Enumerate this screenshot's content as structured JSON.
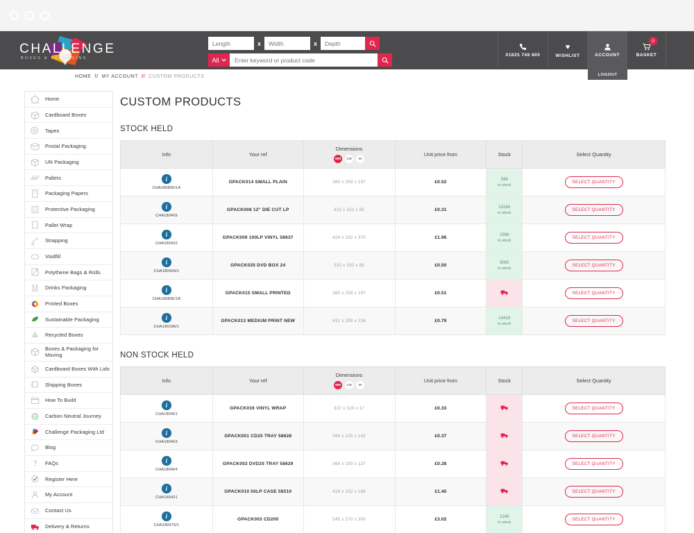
{
  "browser": {
    "dots": 3
  },
  "header": {
    "logo": {
      "name": "CHALLENGE",
      "tagline": "BOXES & PACKAGING"
    },
    "search": {
      "length_placeholder": "Length",
      "width_placeholder": "Width",
      "depth_placeholder": "Depth",
      "separator": "x",
      "category_selected": "All",
      "keyword_placeholder": "Enter keyword or product code",
      "search_icon": "search-icon"
    },
    "utils": [
      {
        "icon": "phone-icon",
        "glyph": "☎",
        "label": "01825 748 800",
        "name": "phone"
      },
      {
        "icon": "heart-icon",
        "glyph": "♥",
        "label": "WISHLIST",
        "name": "wishlist"
      },
      {
        "icon": "user-icon",
        "glyph": "♟",
        "label": "ACCOUNT",
        "name": "account",
        "sub": "LOGOUT"
      },
      {
        "icon": "cart-icon",
        "glyph": "⬟",
        "label": "BASKET",
        "name": "basket",
        "badge": "0"
      }
    ]
  },
  "breadcrumb": {
    "items": [
      "HOME",
      "MY ACCOUNT",
      "CUSTOM PRODUCTS"
    ],
    "separator": "//"
  },
  "sidebar": {
    "items": [
      {
        "label": "Home",
        "icon": "home-icon"
      },
      {
        "label": "Cardboard Boxes",
        "icon": "box-icon"
      },
      {
        "label": "Tapes",
        "icon": "tape-roll-icon"
      },
      {
        "label": "Postal Packaging",
        "icon": "envelope-box-icon"
      },
      {
        "label": "UN Packaging",
        "icon": "un-box-icon"
      },
      {
        "label": "Pallets",
        "icon": "pallet-icon"
      },
      {
        "label": "Packaging Papers",
        "icon": "paper-icon"
      },
      {
        "label": "Protective Packaging",
        "icon": "bubble-wrap-icon"
      },
      {
        "label": "Pallet Wrap",
        "icon": "wrap-icon"
      },
      {
        "label": "Strapping",
        "icon": "strapping-icon"
      },
      {
        "label": "Voidfill",
        "icon": "voidfill-icon"
      },
      {
        "label": "Polythene Bags & Rolls",
        "icon": "poly-bag-icon"
      },
      {
        "label": "Drinks Packaging",
        "icon": "bottles-icon"
      },
      {
        "label": "Printed Boxes",
        "icon": "color-circle-icon"
      },
      {
        "label": "Sustainable Packaging",
        "icon": "leaf-icon"
      },
      {
        "label": "Recycled Boxes",
        "icon": "recycle-icon"
      },
      {
        "label": "Boxes & Packaging for Moving",
        "icon": "moving-box-icon"
      },
      {
        "label": "Cardboard Boxes With Lids",
        "icon": "lidded-box-icon"
      },
      {
        "label": "Shipping Boxes",
        "icon": "shipping-box-icon"
      },
      {
        "label": "How To Build",
        "icon": "clapperboard-icon"
      },
      {
        "label": "Carbon Neutral Journey",
        "icon": "globe-icon"
      },
      {
        "label": "Challenge Packaging Ltd",
        "icon": "brand-icon"
      },
      {
        "label": "Blog",
        "icon": "speech-bubble-icon"
      },
      {
        "label": "FAQs",
        "icon": "question-icon"
      },
      {
        "label": "Register Here",
        "icon": "check-circle-icon"
      },
      {
        "label": "My Account",
        "icon": "person-icon"
      },
      {
        "label": "Contact Us",
        "icon": "mail-icon"
      },
      {
        "label": "Delivery & Returns",
        "icon": "truck-icon"
      }
    ]
  },
  "main": {
    "page_title": "CUSTOM PRODUCTS",
    "columns": [
      "Info",
      "Your ref",
      "Dimensions",
      "Unit price from",
      "Stock",
      "Select Quantity"
    ],
    "unit_toggles": [
      {
        "label": "MM",
        "active": true
      },
      {
        "label": "CM",
        "active": false
      },
      {
        "label": "IN",
        "active": false
      }
    ],
    "select_quantity_label": "SELECT QUANTITY",
    "in_stock_label": "in stock",
    "sections": [
      {
        "title": "STOCK HELD",
        "rows": [
          {
            "ref_code": "CHA180896/1A",
            "your_ref": "GPACK014 SMALL PLAIN",
            "dimensions": "380 x 259 x 197",
            "price": "£0.52",
            "stock_qty": "588",
            "in_stock": true
          },
          {
            "ref_code": "CHA180405",
            "your_ref": "GPACK008 12\" DIE CUT LP",
            "dimensions": "322 x 322 x 85",
            "price": "£0.31",
            "stock_qty": "13166",
            "in_stock": true
          },
          {
            "ref_code": "CHA180432",
            "your_ref": "GPACK009 100LP VINYL 58637",
            "dimensions": "416 x 332 x 370",
            "price": "£1.96",
            "stock_qty": "2396",
            "in_stock": true
          },
          {
            "ref_code": "CHA180469/1",
            "your_ref": "GPACK025 DVD BOX 24",
            "dimensions": "332 x 332 x 85",
            "price": "£0.50",
            "stock_qty": "9000",
            "in_stock": true
          },
          {
            "ref_code": "CHA180896/1B",
            "your_ref": "GPACK015 SMALL PRINTED",
            "dimensions": "380 x 259 x 197",
            "price": "£0.51",
            "stock_qty": "",
            "in_stock": false
          },
          {
            "ref_code": "CHA190186/1",
            "your_ref": "GPACK013 MEDIUM PRINT NEW",
            "dimensions": "431 x 299 x 236",
            "price": "£0.79",
            "stock_qty": "14419",
            "in_stock": true
          }
        ]
      },
      {
        "title": "NON STOCK HELD",
        "rows": [
          {
            "ref_code": "CHA180401",
            "your_ref": "GPACK016 VINYL WRAP",
            "dimensions": "322 x 320 x 17",
            "price": "£0.33",
            "stock_qty": "",
            "in_stock": false
          },
          {
            "ref_code": "CHA180403",
            "your_ref": "GPACK001 CD25 TRAY 58628",
            "dimensions": "264 x 125 x 142",
            "price": "£0.37",
            "stock_qty": "",
            "in_stock": false
          },
          {
            "ref_code": "CHA180404",
            "your_ref": "GPACK002 DVD25 TRAY 58629",
            "dimensions": "368 x 193 x 137",
            "price": "£0.28",
            "stock_qty": "",
            "in_stock": false
          },
          {
            "ref_code": "CHA180431",
            "your_ref": "GPACK010 50LP CASE 59210",
            "dimensions": "416 x 332 x 185",
            "price": "£1.40",
            "stock_qty": "",
            "in_stock": false
          },
          {
            "ref_code": "CHA180476/1",
            "your_ref": "GPACK003 CD200",
            "dimensions": "545 x 270 x 300",
            "price": "£3.02",
            "stock_qty": "1246",
            "in_stock": true
          }
        ]
      }
    ]
  },
  "colors": {
    "accent_pink": "#e0264f",
    "header_dark": "#4b4b4d",
    "info_blue": "#1e6e9e",
    "stock_in_bg": "#e1f4ea",
    "stock_out_bg": "#fbe3ea"
  }
}
